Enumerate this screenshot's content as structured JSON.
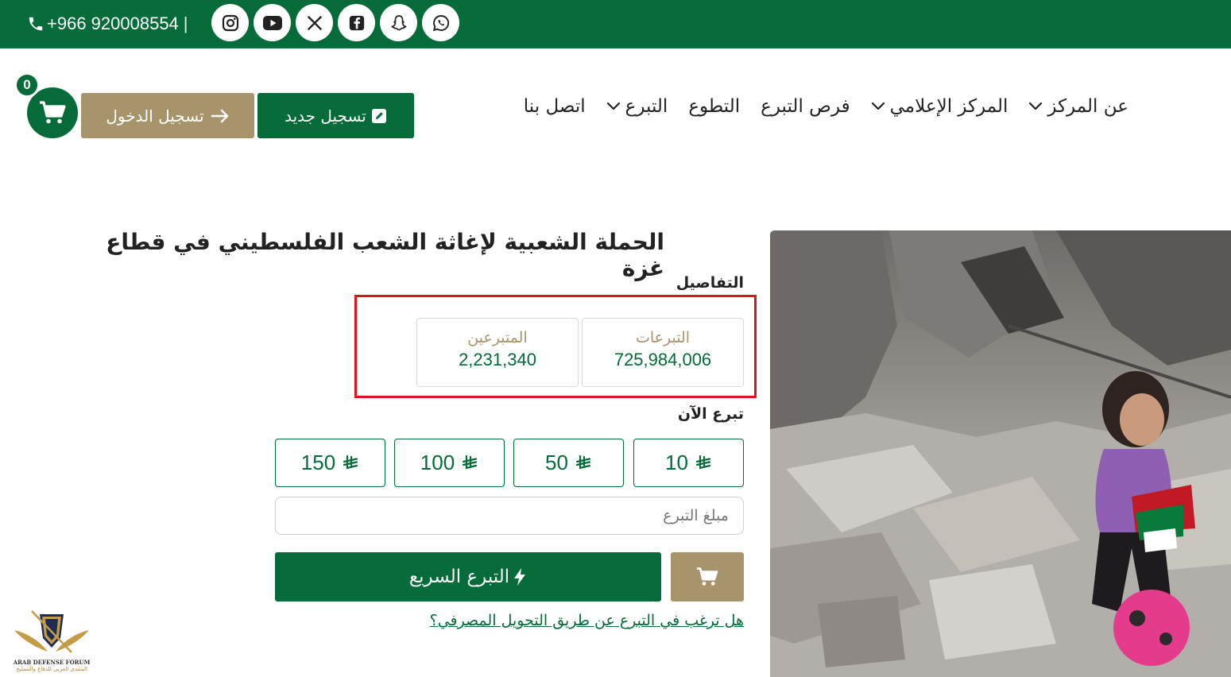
{
  "topbar": {
    "phone": "+966 920008554",
    "separator": "|",
    "socials": [
      "instagram-icon",
      "youtube-icon",
      "x-icon",
      "facebook-icon",
      "snapchat-icon",
      "whatsapp-icon"
    ]
  },
  "header": {
    "cart_count": "0",
    "login_label": "تسجيل الدخول",
    "register_label": "تسجيل جديد",
    "nav": [
      {
        "label": "عن المركز",
        "dropdown": true
      },
      {
        "label": "المركز الإعلامي",
        "dropdown": true
      },
      {
        "label": "فرص التبرع",
        "dropdown": false
      },
      {
        "label": "التطوع",
        "dropdown": false
      },
      {
        "label": "التبرع",
        "dropdown": true
      },
      {
        "label": "اتصل بنا",
        "dropdown": false
      }
    ]
  },
  "campaign": {
    "title": "الحملة الشعبية لإغاثة الشعب الفلسطيني في قطاع غزة",
    "details_label": "التفاصيل",
    "stats": {
      "donations_label": "التبرعات",
      "donations_value": "725,984,006",
      "donors_label": "المتبرعين",
      "donors_value": "2,231,340"
    },
    "donate_now_label": "تبرع الآن",
    "amounts": [
      "10",
      "50",
      "100",
      "150"
    ],
    "amount_placeholder": "مبلغ التبرع",
    "quick_donate_label": "التبرع السريع",
    "bank_transfer_link": "هل ترغب في التبرع عن طريق التحويل المصرفي؟"
  },
  "watermark": {
    "line1": "ARAB DEFENSE FORUM",
    "line2": "المنتدى العربي للدفاع والتسليح"
  },
  "colors": {
    "primary_green": "#046b39",
    "gold": "#a8946a",
    "highlight_red": "#e0141e"
  }
}
